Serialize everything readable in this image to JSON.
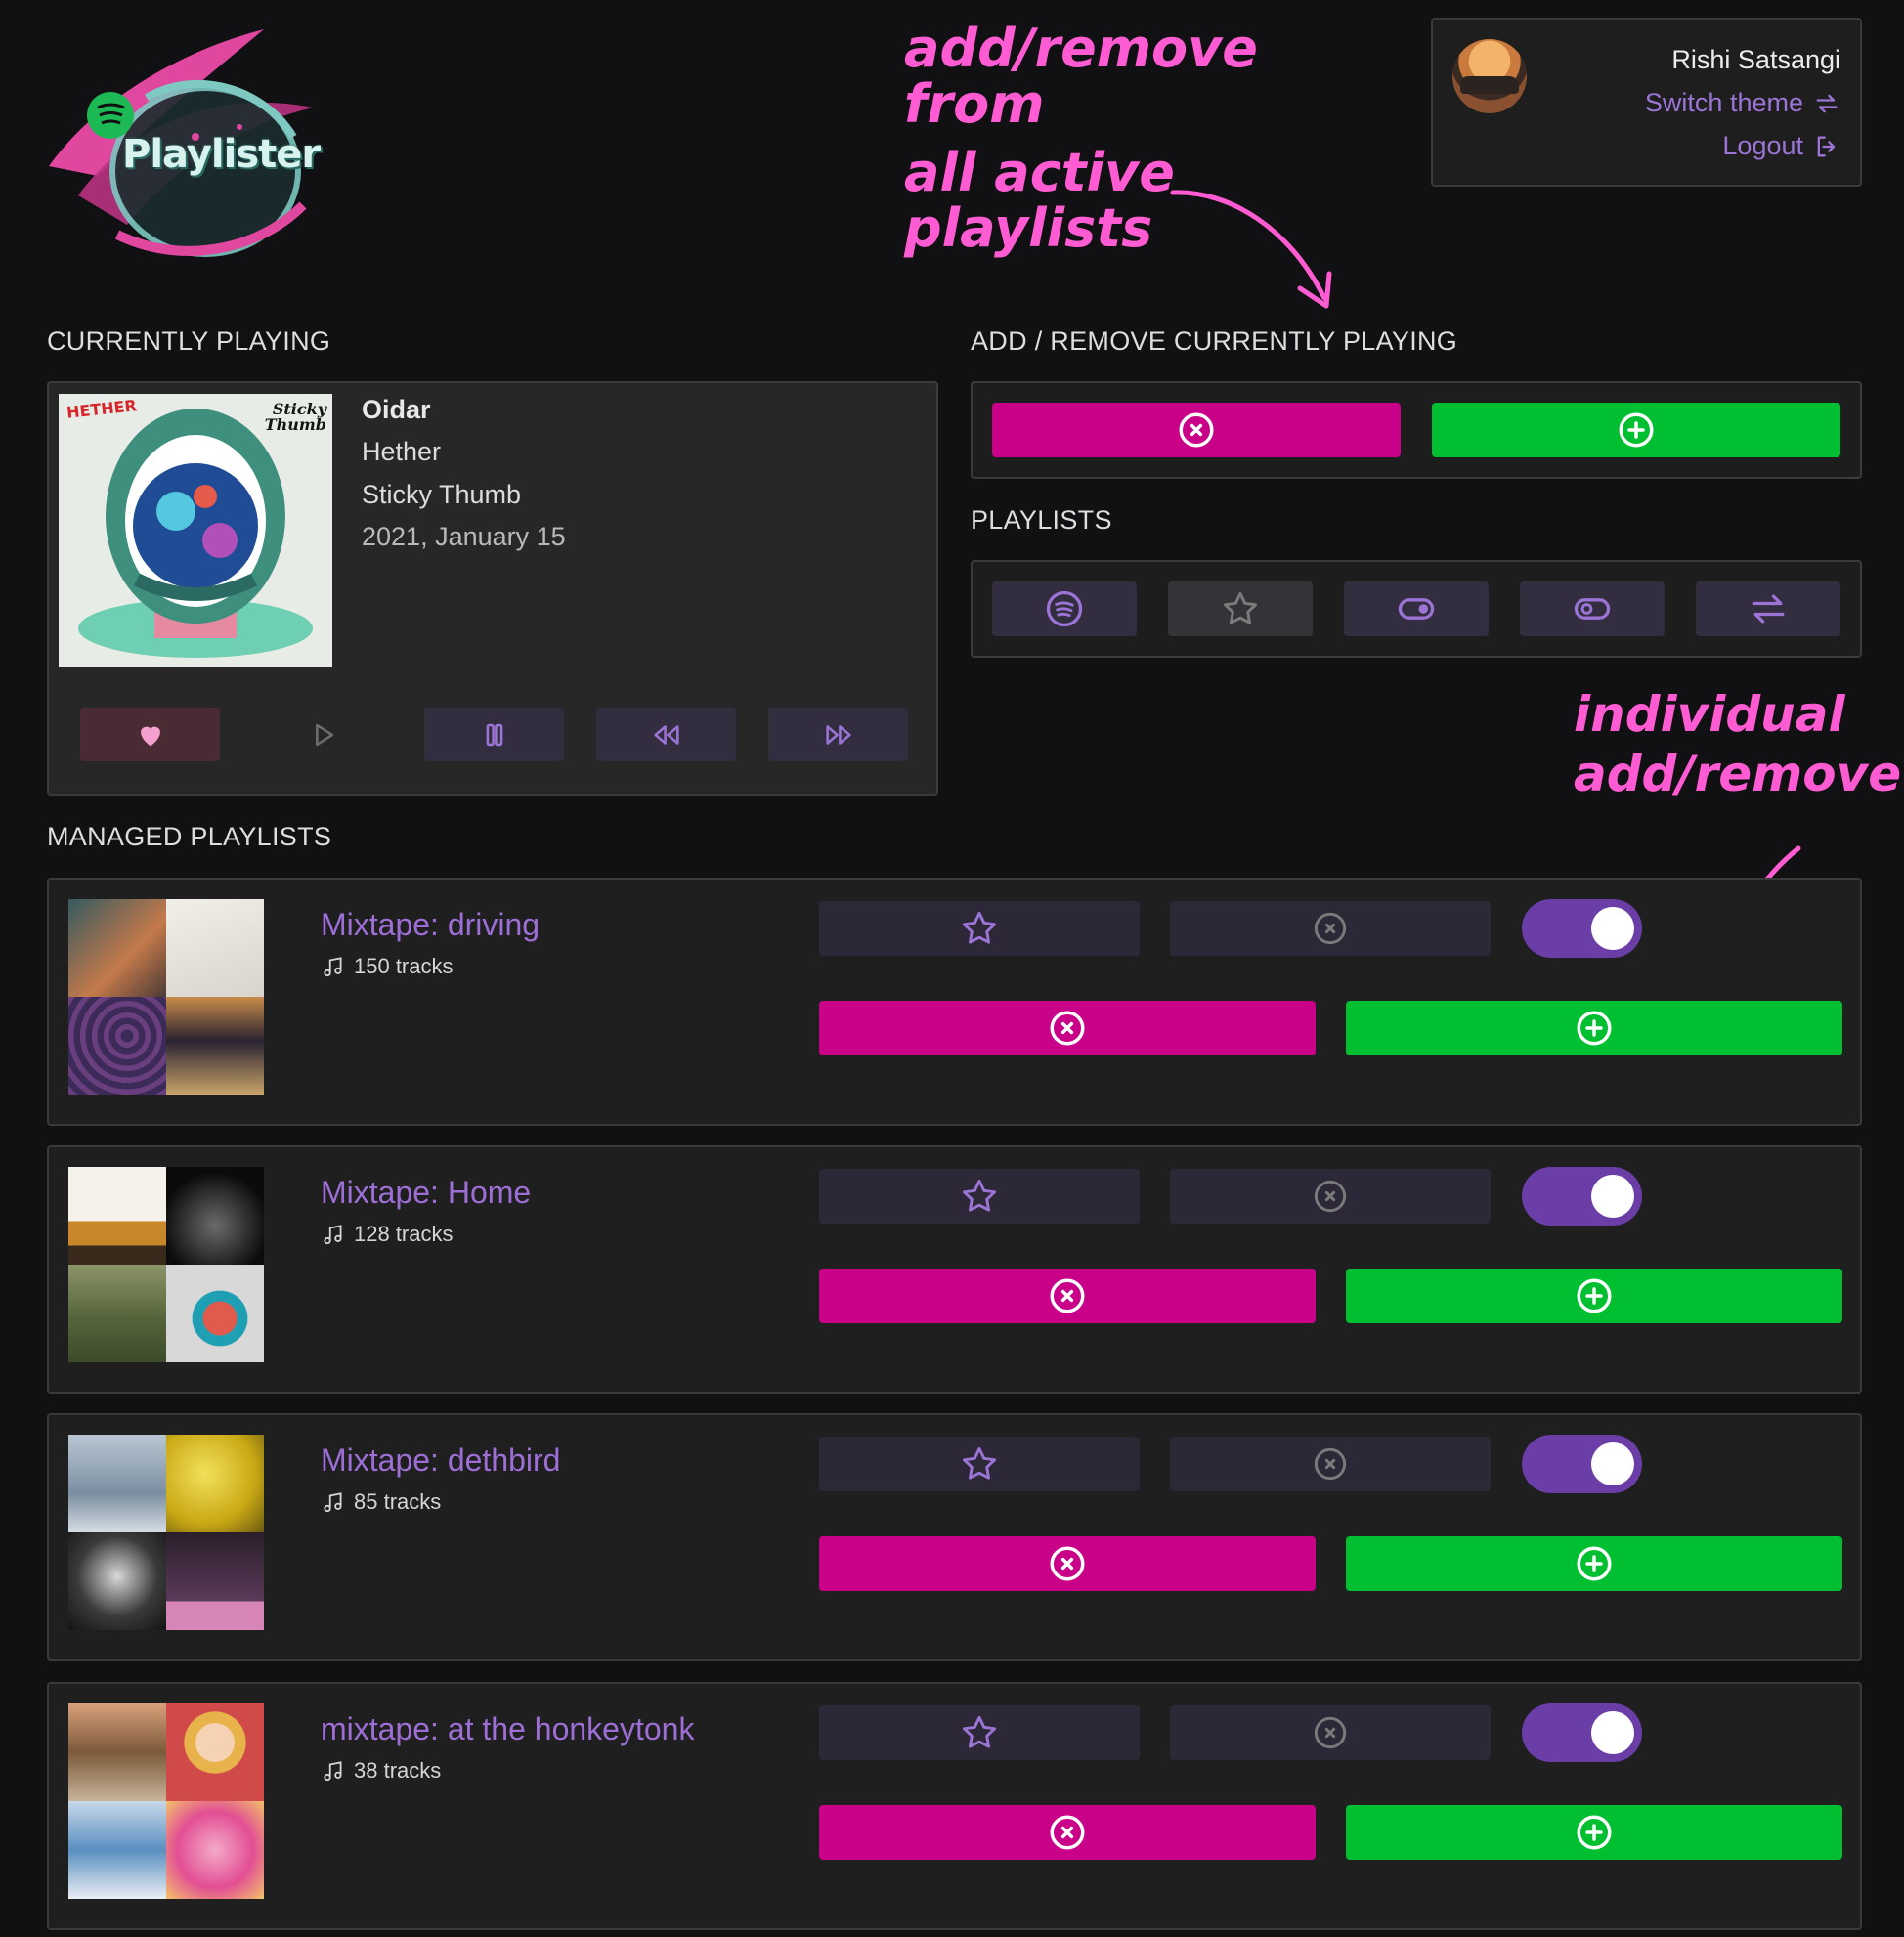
{
  "logo": {
    "text": "Playlister"
  },
  "annotations": {
    "top_line1": "add/remove from",
    "top_line2": "all active playlists",
    "side_line1": "individual",
    "side_line2": "add/remove"
  },
  "user": {
    "name": "Rishi Satsangi",
    "switch_theme": "Switch theme",
    "logout": "Logout"
  },
  "sections": {
    "currently_playing": "CURRENTLY PLAYING",
    "add_remove": "ADD / REMOVE CURRENTLY PLAYING",
    "playlists": "PLAYLISTS",
    "managed": "MANAGED PLAYLISTS"
  },
  "now_playing": {
    "title": "Oidar",
    "artist": "Hether",
    "album": "Sticky Thumb",
    "date": "2021, January 15",
    "cover_text_left": "HETHER",
    "cover_text_right": "Sticky Thumb"
  },
  "icons": {
    "heart": "heart-icon",
    "play": "play-icon",
    "pause": "pause-icon",
    "rewind": "rewind-icon",
    "forward": "fast-forward-icon",
    "spotify": "spotify-icon",
    "star": "star-icon",
    "toggle_on": "toggle-on-icon",
    "toggle_off": "toggle-off-icon",
    "shuffle": "swap-arrows-icon"
  },
  "colors": {
    "remove": "#c90088",
    "add": "#00c032",
    "accent": "#9d6fd6",
    "toggle": "#6a3ea6",
    "annotation": "#ff5bd2"
  },
  "managed_playlists": [
    {
      "name": "Mixtape: driving",
      "tracks": "150 tracks",
      "active": true
    },
    {
      "name": "Mixtape: Home",
      "tracks": "128 tracks",
      "active": true
    },
    {
      "name": "Mixtape: dethbird",
      "tracks": "85 tracks",
      "active": true
    },
    {
      "name": "mixtape: at the honkeytonk",
      "tracks": "38 tracks",
      "active": true
    }
  ]
}
